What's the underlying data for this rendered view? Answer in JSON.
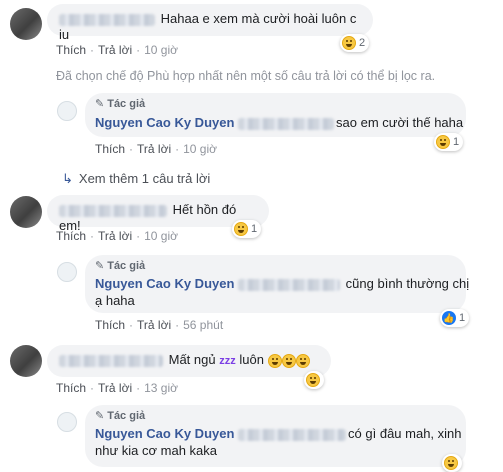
{
  "actions": {
    "like": "Thích",
    "reply": "Trả lời"
  },
  "author_badge": "Tác giả",
  "author_name": "Nguyen Cao Ky Duyen",
  "filter_notice": "Đã chọn chế độ Phù hợp nhất nên một số câu trả lời có thể bị lọc ra.",
  "view_more": "Xem thêm 1 câu trả lời",
  "comments": [
    {
      "text": "Hahaa e xem mà cười hoài luôn c iu",
      "time": "10 giờ",
      "reaction_icon": "haha-emoji",
      "reaction_count": "2"
    },
    {
      "text": "sao em cười thế haha",
      "time": "10 giờ",
      "reaction_icon": "haha-emoji",
      "reaction_count": "1"
    },
    {
      "text": "Hết hồn đó em!",
      "time": "10 giờ",
      "reaction_icon": "haha-emoji",
      "reaction_count": "1"
    },
    {
      "text": "cũng bình thường chị",
      "text2": "ạ haha",
      "time": "56 phút",
      "reaction_icon": "like-icon",
      "reaction_count": "1"
    },
    {
      "text": "Mất ngủ",
      "zzz": "zzz",
      "text_after": "luôn",
      "time": "13 giờ",
      "reaction_icon": "haha-emoji",
      "reaction_count": ""
    },
    {
      "text": "có gì đâu mah, xinh",
      "text2": "như kia cơ mah kaka"
    }
  ]
}
